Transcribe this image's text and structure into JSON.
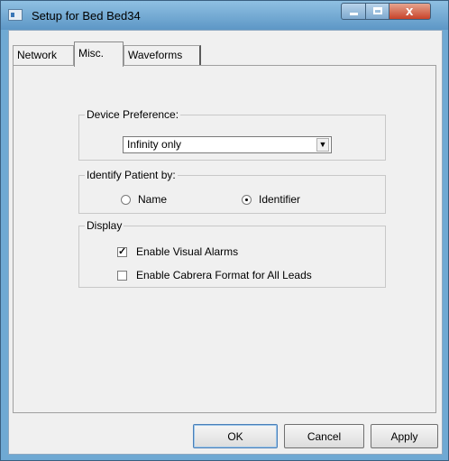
{
  "window": {
    "title": "Setup for Bed  Bed34",
    "controls": {
      "minimize_icon": "minimize-icon",
      "maximize_icon": "maximize-icon",
      "close_icon": "close-icon",
      "close_glyph": "x"
    }
  },
  "tabs": [
    {
      "label": "Network",
      "selected": false
    },
    {
      "label": "Misc.",
      "selected": true
    },
    {
      "label": "Waveforms",
      "selected": false
    }
  ],
  "device_preference": {
    "label": "Device Preference:",
    "selected": "Infinity only",
    "arrow": "▼"
  },
  "identify_patient": {
    "label": "Identify Patient by:",
    "options": [
      {
        "label": "Name",
        "checked": false
      },
      {
        "label": "Identifier",
        "checked": true
      }
    ]
  },
  "display": {
    "label": "Display",
    "checkboxes": [
      {
        "label": "Enable Visual Alarms",
        "checked": true
      },
      {
        "label": "Enable Cabrera Format for All Leads",
        "checked": false
      }
    ]
  },
  "buttons": {
    "ok": "OK",
    "cancel": "Cancel",
    "apply": "Apply"
  },
  "colors": {
    "frame": "#6fa9d3",
    "close_button": "#c8432a",
    "dialog_background": "#f0f0f0"
  }
}
